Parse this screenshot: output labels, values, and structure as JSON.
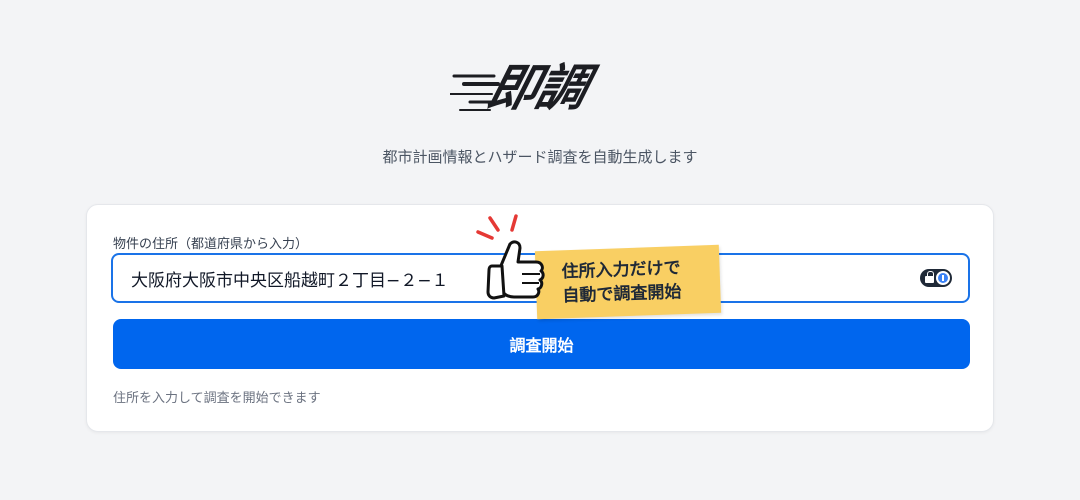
{
  "logo": {
    "text": "即調"
  },
  "tagline": "都市計画情報とハザード調査を自動生成します",
  "form": {
    "label": "物件の住所（都道府県から入力）",
    "address_value": "大阪府大阪市中央区船越町２丁目−２−１",
    "button_label": "調査開始",
    "hint": "住所を入力して調査を開始できます"
  },
  "callout": {
    "line1": "住所入力だけで",
    "line2": "自動で調査開始"
  },
  "icons": {
    "password_manager": "password-manager-icon",
    "thumbs_up": "thumbs-up-icon"
  },
  "colors": {
    "primary": "#0066ee",
    "input_border": "#1a73e8",
    "callout_bg": "#f9cf63",
    "burst": "#e53935"
  }
}
